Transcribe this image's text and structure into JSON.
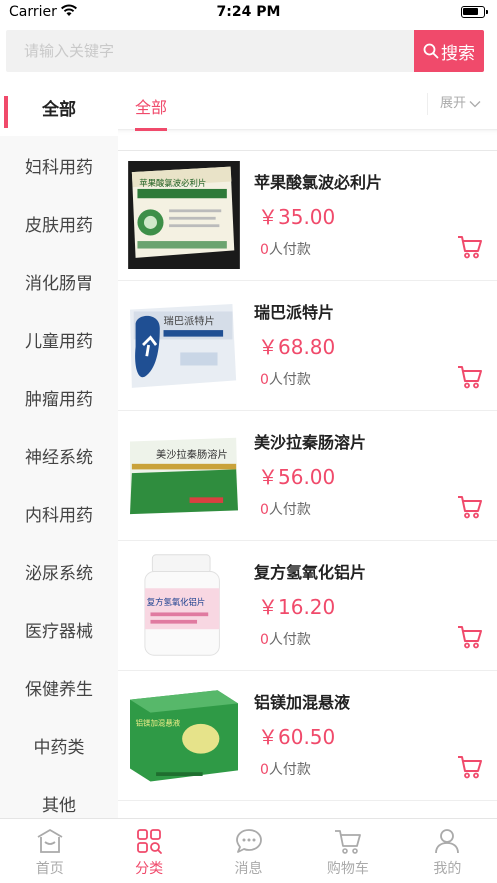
{
  "status": {
    "carrier": "Carrier",
    "time": "7:24 PM"
  },
  "search": {
    "placeholder": "请输入关键字",
    "button_label": "搜索"
  },
  "sidebar": {
    "items": [
      {
        "label": "全部",
        "active": true
      },
      {
        "label": "妇科用药"
      },
      {
        "label": "皮肤用药"
      },
      {
        "label": "消化肠胃"
      },
      {
        "label": "儿童用药"
      },
      {
        "label": "肿瘤用药"
      },
      {
        "label": "神经系统"
      },
      {
        "label": "内科用药"
      },
      {
        "label": "泌尿系统"
      },
      {
        "label": "医疗器械"
      },
      {
        "label": "保健养生"
      },
      {
        "label": "中药类"
      },
      {
        "label": "其他"
      }
    ]
  },
  "main": {
    "active_tab": "全部",
    "expand_label": "展开",
    "products": [
      {
        "name": "苹果酸氯波必利片",
        "price": "￥35.00",
        "buyers_count": "0",
        "buyers_suffix": "人付款",
        "box_text": "苹果酸氯波必利片"
      },
      {
        "name": "瑞巴派特片",
        "price": "￥68.80",
        "buyers_count": "0",
        "buyers_suffix": "人付款",
        "box_text": "瑞巴派特片"
      },
      {
        "name": "美沙拉秦肠溶片",
        "price": "￥56.00",
        "buyers_count": "0",
        "buyers_suffix": "人付款",
        "box_text": "美沙拉秦肠溶片"
      },
      {
        "name": "复方氢氧化铝片",
        "price": "￥16.20",
        "buyers_count": "0",
        "buyers_suffix": "人付款",
        "box_text": "复方氢氧化铝片"
      },
      {
        "name": "铝镁加混悬液",
        "price": "￥60.50",
        "buyers_count": "0",
        "buyers_suffix": "人付款",
        "box_text": "铝镁加混悬液"
      }
    ]
  },
  "tabbar": {
    "items": [
      {
        "label": "首页",
        "icon": "home-icon"
      },
      {
        "label": "分类",
        "icon": "category-icon",
        "active": true
      },
      {
        "label": "消息",
        "icon": "message-icon"
      },
      {
        "label": "购物车",
        "icon": "cart-icon"
      },
      {
        "label": "我的",
        "icon": "user-icon"
      }
    ]
  },
  "colors": {
    "accent": "#f04a6b"
  }
}
